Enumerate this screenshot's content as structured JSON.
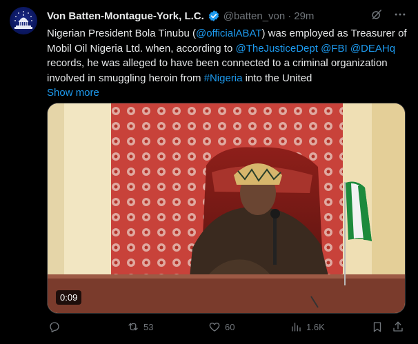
{
  "tweet": {
    "author_name": "Von Batten-Montague-York, L.C.",
    "handle": "@batten_von",
    "dot": "·",
    "time": "29m",
    "text": {
      "t1": "Nigerian President Bola Tinubu (",
      "m1": "@officialABAT",
      "t2": ") was employed as Treasurer of Mobil Oil Nigeria Ltd. when, according to ",
      "m2": "@TheJusticeDept",
      "t3": " ",
      "m3": "@FBI",
      "t4": " ",
      "m4": "@DEAHq",
      "t5": " records, he was alleged to have been connected to a criminal organization involved in smuggling heroin from ",
      "h1": "#Nigeria",
      "t6": " into the United"
    },
    "show_more": "Show more",
    "video_time": "0:09"
  },
  "actions": {
    "retweets": "53",
    "likes": "60",
    "views": "1.6K"
  },
  "icons": {
    "grok": "grok-icon",
    "more": "more-icon",
    "reply": "reply-icon",
    "retweet": "retweet-icon",
    "like": "heart-icon",
    "views": "views-icon",
    "bookmark": "bookmark-icon",
    "share": "share-icon"
  },
  "colors": {
    "link": "#1d9bf0",
    "verified": "#1d9bf0",
    "muted": "#71767b",
    "background": "#000000"
  }
}
